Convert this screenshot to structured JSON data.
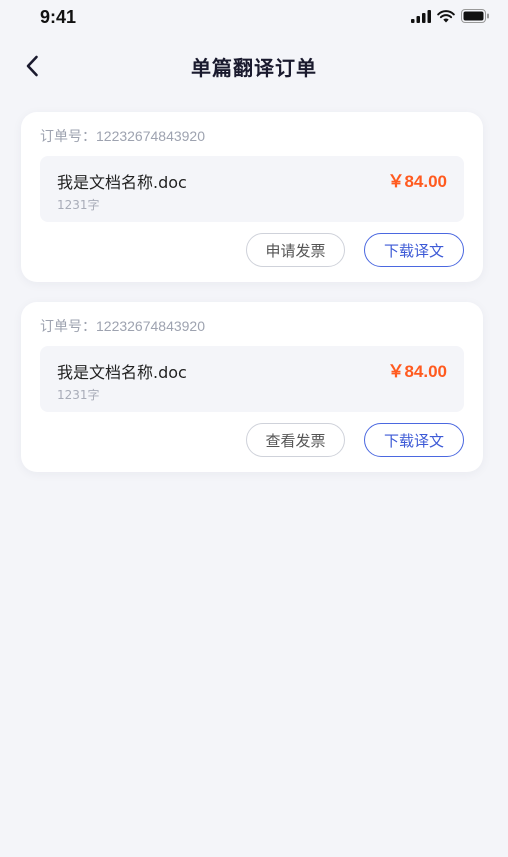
{
  "status_bar": {
    "time": "9:41",
    "icons": [
      "cellular-signal-icon",
      "wifi-icon",
      "battery-icon"
    ]
  },
  "nav": {
    "back_icon": "chevron-left-icon",
    "title": "单篇翻译订单"
  },
  "orders": [
    {
      "order_no": "订单号：12232674843920",
      "doc_name": "我是文档名称.doc",
      "word_count": "1231字",
      "price": "￥84.00",
      "invoice_button": "申请发票",
      "download_button": "下载译文"
    },
    {
      "order_no": "订单号：12232674843920",
      "doc_name": "我是文档名称.doc",
      "word_count": "1231字",
      "price": "￥84.00",
      "invoice_button": "查看发票",
      "download_button": "下载译文"
    }
  ],
  "colors": {
    "background": "#f4f5f9",
    "price": "#ff5a1f",
    "primary_button": "#4b68e0",
    "title": "#1a1a2e"
  }
}
